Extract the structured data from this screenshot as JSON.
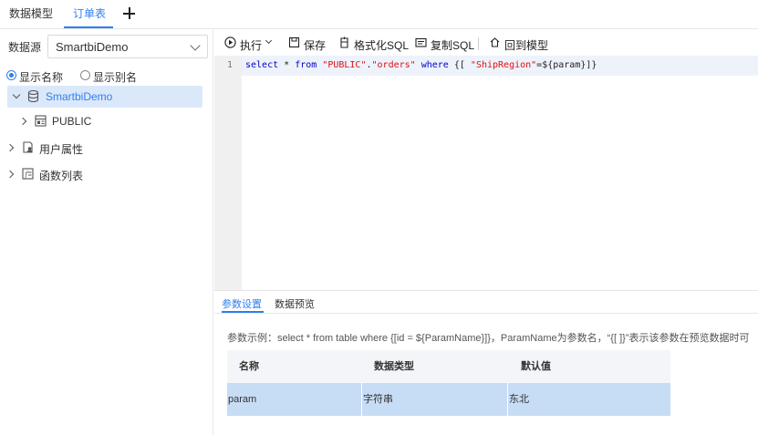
{
  "tabs": [
    {
      "label": "数据模型"
    },
    {
      "label": "订单表"
    }
  ],
  "left": {
    "datasource_label": "数据源",
    "datasource_value": "SmartbiDemo",
    "radios": [
      {
        "label": "显示名称",
        "checked": true
      },
      {
        "label": "显示别名",
        "checked": false
      }
    ],
    "tree": [
      {
        "label": "SmartbiDemo",
        "expanded": true,
        "selected": true,
        "icon": "database-icon"
      },
      {
        "label": "PUBLIC",
        "expanded": false,
        "icon": "schema-icon"
      },
      {
        "label": "用户属性",
        "expanded": false,
        "icon": "user-attribute-icon"
      },
      {
        "label": "函数列表",
        "expanded": false,
        "icon": "function-list-icon"
      }
    ]
  },
  "toolbar": {
    "run": "执行",
    "save": "保存",
    "format": "格式化SQL",
    "copy": "复制SQL",
    "back": "回到模型"
  },
  "editor": {
    "line_number": "1",
    "tokens": {
      "t1": "select",
      "t2": " * ",
      "t3": "from",
      "t4": " ",
      "t5": "\"PUBLIC\"",
      "t6": ".",
      "t7": "\"orders\"",
      "t8": " ",
      "t9": "where",
      "t10": " {[ ",
      "t11": "\"ShipRegion\"",
      "t12": "=${param}]}"
    }
  },
  "bottom_tabs": [
    {
      "label": "参数设置",
      "active": true
    },
    {
      "label": "数据预览",
      "active": false
    }
  ],
  "hint": "参数示例：select * from table where {[id = ${ParamName}]}，ParamName为参数名，“{[ ]}”表示该参数在预览数据时可",
  "param_table": {
    "headers": [
      "名称",
      "数据类型",
      "默认值"
    ],
    "rows": [
      [
        "param",
        "字符串",
        "东北"
      ]
    ]
  },
  "colors": {
    "accent": "#2f7ff0",
    "selected_row": "#c7dcf5",
    "keyword": "#0000cc",
    "string": "#dd1111"
  }
}
